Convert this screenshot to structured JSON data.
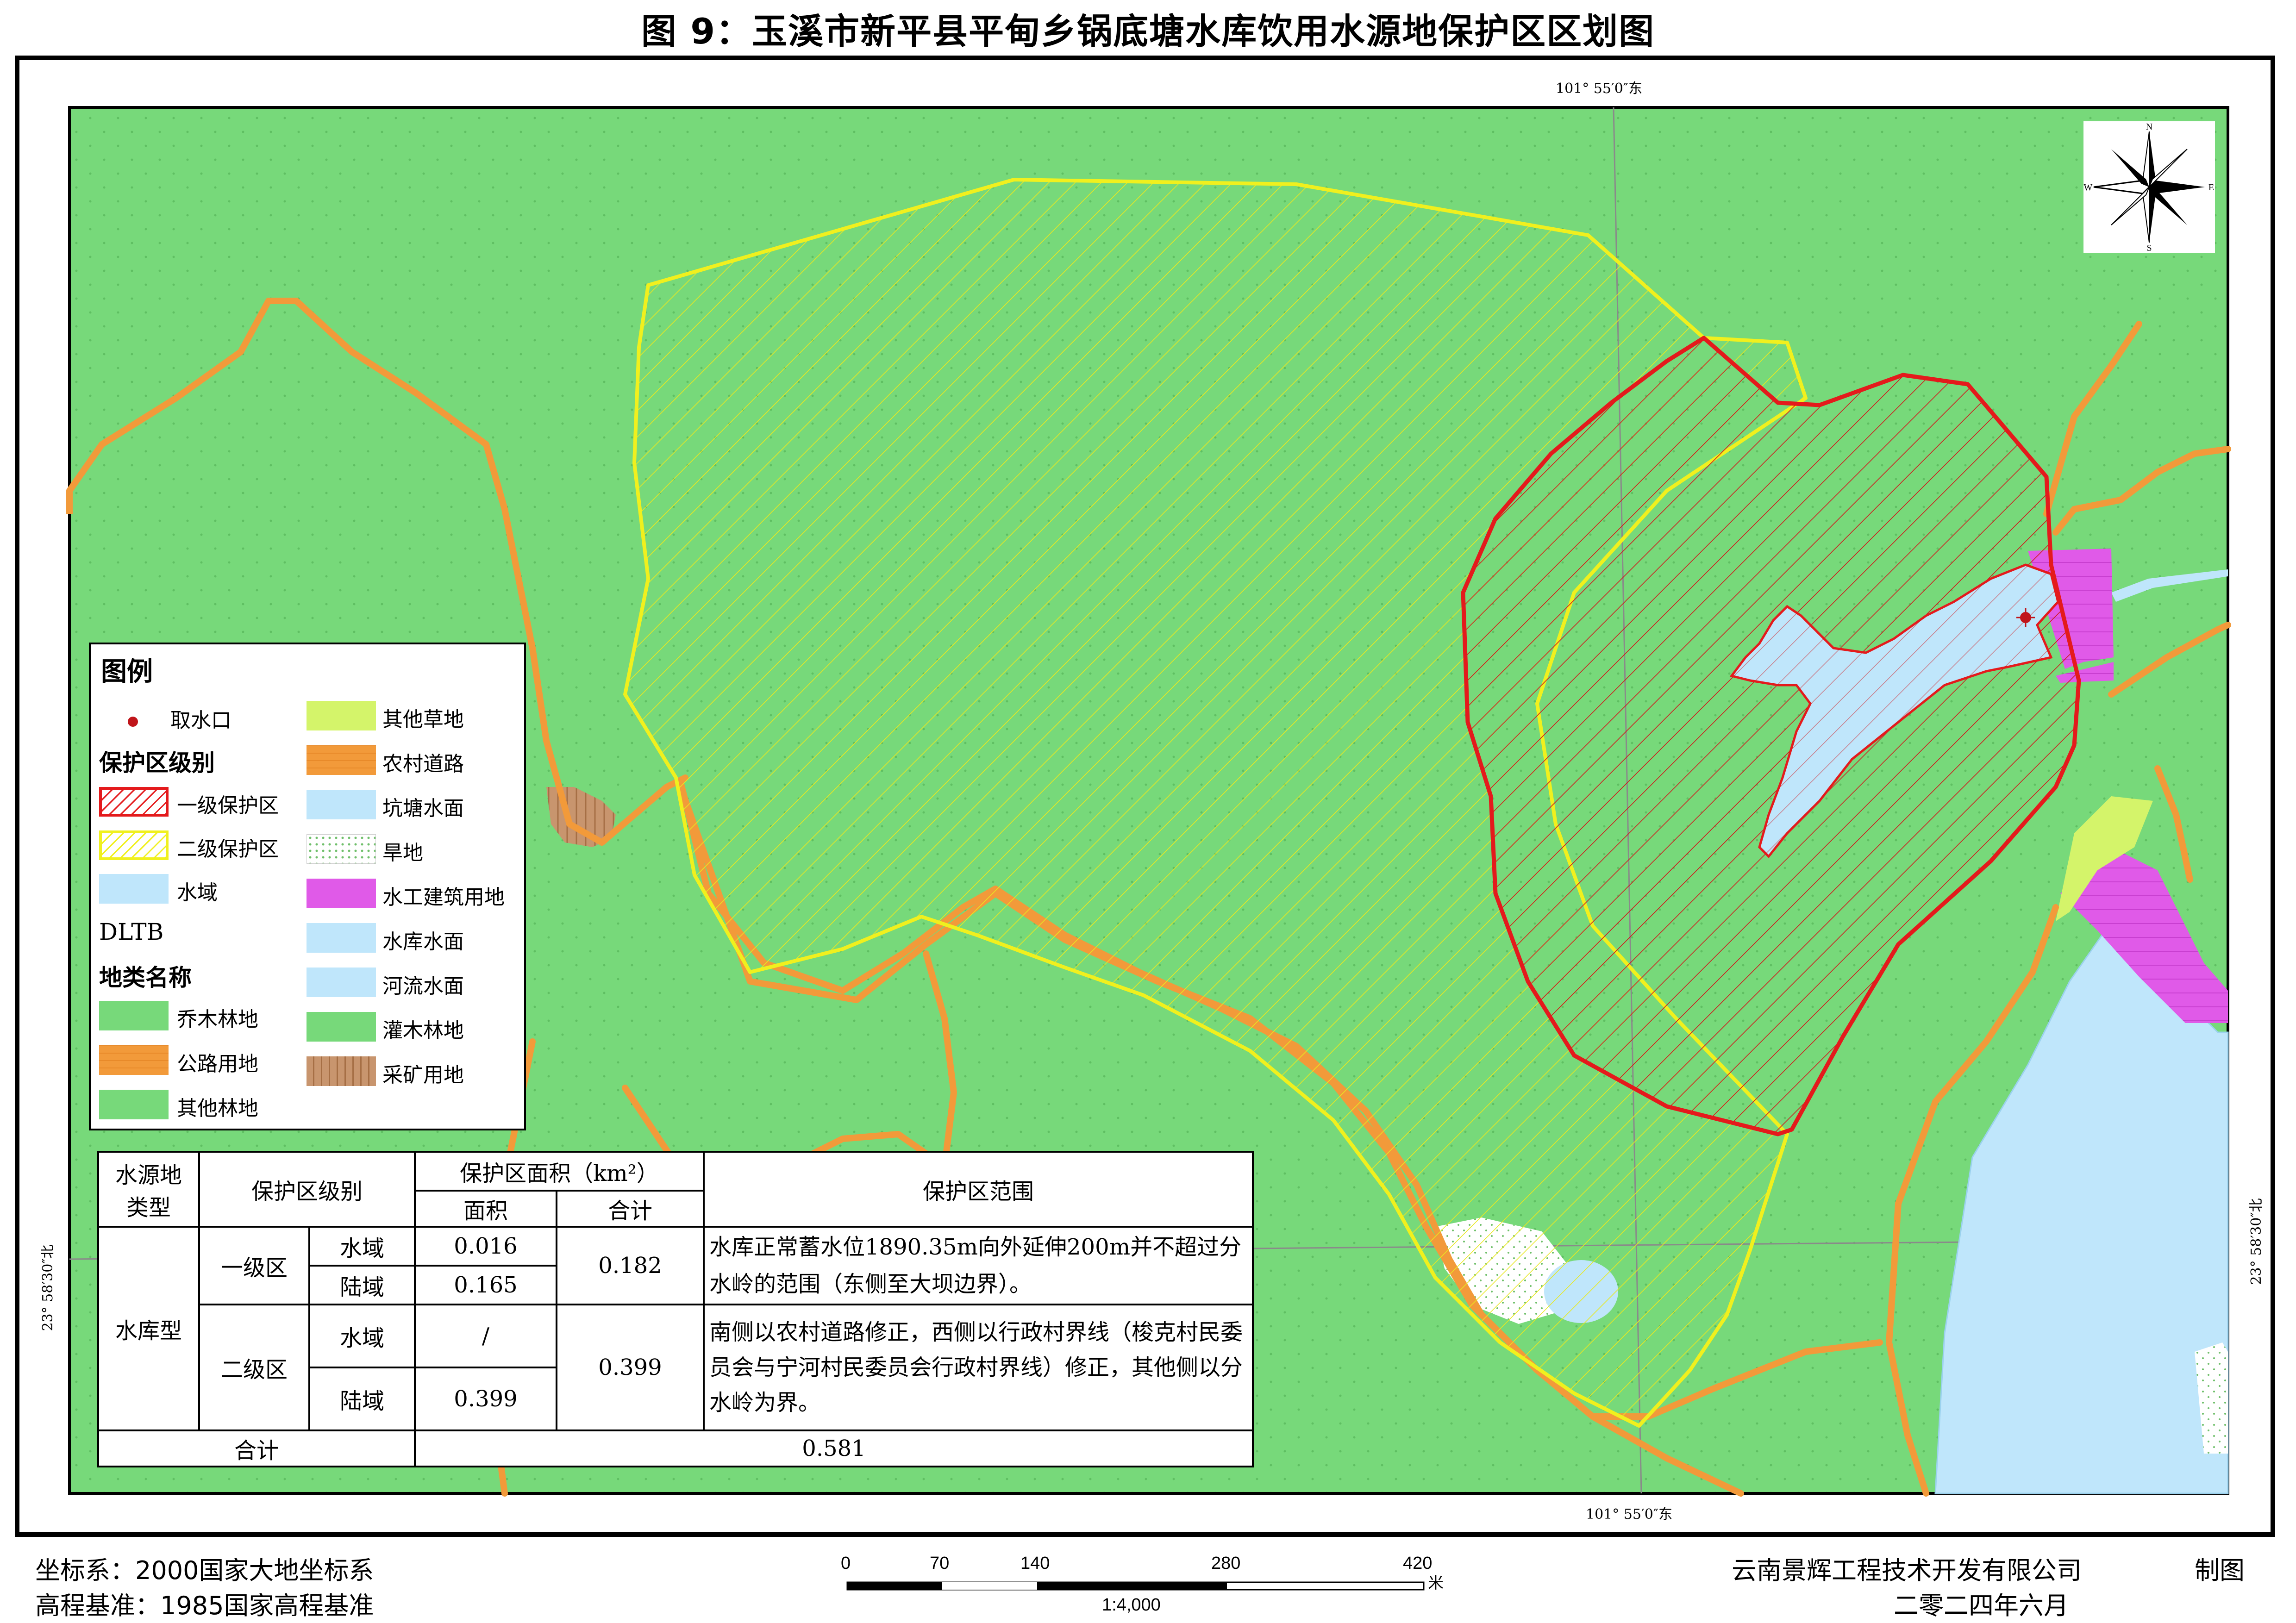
{
  "title": "图 9：玉溪市新平县平甸乡锅底塘水库饮用水源地保护区区划图",
  "coords": {
    "top_lon": "101° 55′0″东",
    "bottom_lon": "101° 55′0″东",
    "left_lat": "23° 58′30″北",
    "right_lat": "23° 58′30″北"
  },
  "compass": {
    "n": "N",
    "s": "S",
    "e": "E",
    "w": "W"
  },
  "legend": {
    "title": "图例",
    "intake": "取水口",
    "protect_heading": "保护区级别",
    "level1": "一级保护区",
    "level2": "二级保护区",
    "water": "水域",
    "dltb": "DLTB",
    "landclass_heading": "地类名称",
    "left_items": [
      "乔木林地",
      "公路用地",
      "其他林地"
    ],
    "right_items": [
      "其他草地",
      "农村道路",
      "坑塘水面",
      "旱地",
      "水工建筑用地",
      "水库水面",
      "河流水面",
      "灌木林地",
      "采矿用地"
    ]
  },
  "colors": {
    "forest": "#77d97a",
    "road": "#f29a3a",
    "water": "#bfe6fb",
    "level1": "#e41a1c",
    "level2": "#f0f01e",
    "hydraulic": "#e05ae8",
    "grass": "#d4f46a",
    "mining": "#c8956e"
  },
  "table": {
    "h_type": "水源地类型",
    "h_type_1": "水源地",
    "h_type_2": "类型",
    "h_level": "保护区级别",
    "h_area": "保护区面积（km²）",
    "h_area_sub": "面积",
    "h_total_sub": "合计",
    "h_range": "保护区范围",
    "type": "水库型",
    "level1": "一级区",
    "level2": "二级区",
    "water": "水域",
    "land": "陆域",
    "l1_water_area": "0.016",
    "l1_land_area": "0.165",
    "l1_total": "0.182",
    "l2_water_area": "/",
    "l2_land_area": "0.399",
    "l2_total": "0.399",
    "l1_range": "水库正常蓄水位1890.35m向外延伸200m并不超过分水岭的范围（东侧至大坝边界）。",
    "l2_range": "南侧以农村道路修正，西侧以行政村界线（梭克村民委员会与宁河村民委员会行政村界线）修正，其他侧以分水岭为界。",
    "sum_label": "合计",
    "sum_value": "0.581"
  },
  "footer": {
    "crs": "坐标系：2000国家大地坐标系",
    "datum": "高程基准：1985国家高程基准",
    "org": "云南景辉工程技术开发有限公司",
    "made": "制图",
    "date": "二零二四年六月",
    "scale_ticks": [
      "0",
      "70",
      "140",
      "280",
      "420"
    ],
    "scale_unit": "米",
    "scale_ratio": "1:4,000"
  }
}
